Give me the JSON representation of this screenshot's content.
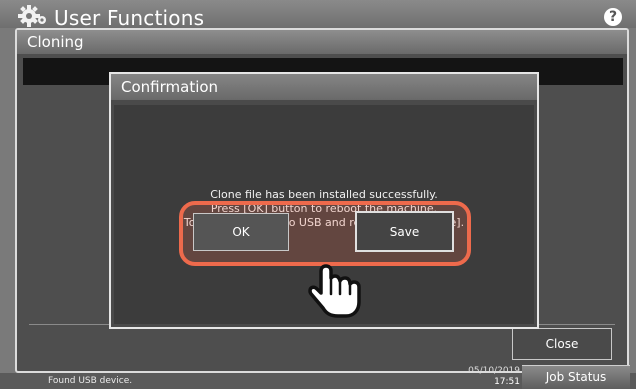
{
  "app": {
    "title": "User Functions",
    "help_icon": "?"
  },
  "window": {
    "title": "Cloning",
    "close_label": "Close"
  },
  "dialog": {
    "title": "Confirmation",
    "message": [
      "Clone file has been installed successfully.",
      "Press [OK] button to reboot the machine.",
      "To save the result to USB and reboot, press [Save]."
    ],
    "ok_label": "OK",
    "save_label": "Save"
  },
  "statusbar": {
    "message": "Found USB device.",
    "date": "05/10/2019",
    "time": "17:51",
    "job_status_label": "Job Status"
  },
  "colors": {
    "highlight": "#ee6a4c",
    "background": "#7a7a7a",
    "dialog": "#3c3c3c"
  },
  "icons": {
    "app_icon": "gear-icon",
    "help": "help-icon",
    "pointer": "hand-pointer-icon"
  }
}
